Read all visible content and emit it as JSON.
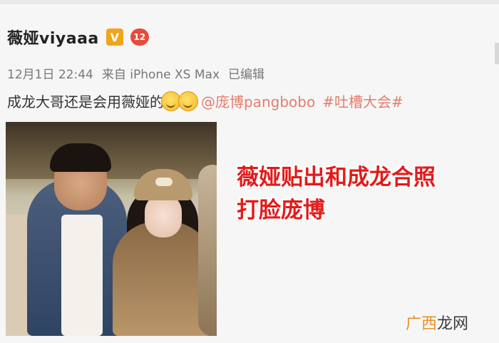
{
  "post": {
    "username": "薇娅viyaaa",
    "verified_mark": "V",
    "vip_badge": "12",
    "meta": {
      "timestamp": "12月1日 22:44",
      "source": "来自 iPhone XS Max",
      "edited": "已编辑"
    },
    "text": "成龙大哥还是会用薇娅的",
    "mention": "@庞博pangbobo",
    "hashtag": "#吐槽大会#"
  },
  "caption": {
    "line1": "薇娅贴出和成龙合照",
    "line2": "打脸庞博"
  },
  "watermark": {
    "part1": "广西",
    "part2": "龙网"
  },
  "icons": {
    "verified": "verified-badge-icon",
    "vip": "vip-level-icon",
    "emoji": "grin-emoji-icon"
  },
  "colors": {
    "link": "#e47d6b",
    "caption": "#e21b1b",
    "verified": "#f0a51c"
  }
}
